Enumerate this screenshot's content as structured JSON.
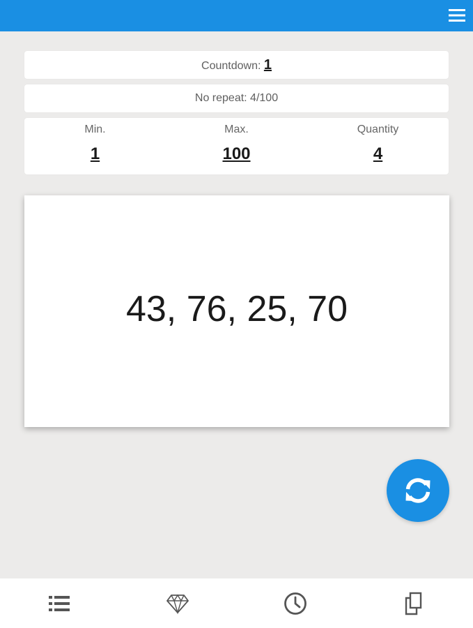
{
  "colors": {
    "accent": "#1a8fe3",
    "background": "#ecebea",
    "card": "#ffffff"
  },
  "topbar": {
    "menu_icon": "hamburger-menu-icon"
  },
  "countdown": {
    "label": "Countdown: ",
    "value": "1"
  },
  "no_repeat": {
    "text": "No repeat: 4/100"
  },
  "range": {
    "min_label": "Min.",
    "min_value": "1",
    "max_label": "Max.",
    "max_value": "100",
    "quantity_label": "Quantity",
    "quantity_value": "4"
  },
  "result": {
    "numbers": "43, 76, 25, 70"
  },
  "fab": {
    "icon": "refresh-icon"
  },
  "bottom_nav": [
    {
      "icon": "list-icon"
    },
    {
      "icon": "diamond-icon"
    },
    {
      "icon": "clock-icon"
    },
    {
      "icon": "copy-icon"
    }
  ]
}
